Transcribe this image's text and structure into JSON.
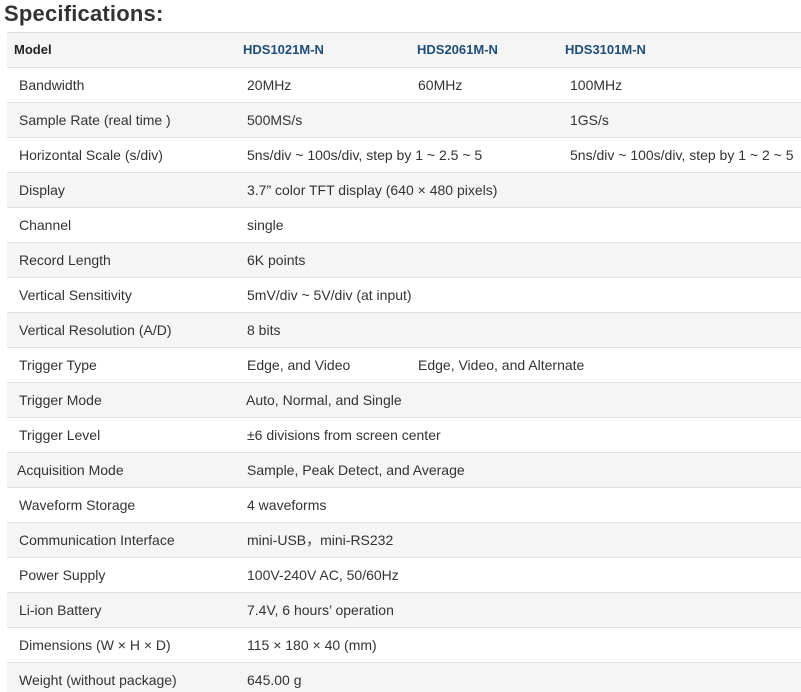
{
  "title": "Specifications:",
  "header": {
    "label": "Model",
    "models": [
      "HDS1021M-N",
      "HDS2061M-N",
      "HDS3101M-N"
    ]
  },
  "rows": [
    {
      "label": "Bandwidth",
      "v1": "20MHz",
      "v2": "60MHz",
      "v3": "100MHz"
    },
    {
      "label": "Sample Rate (real time )",
      "v1": "500MS/s",
      "v3": "1GS/s"
    },
    {
      "label": "Horizontal Scale (s/div)",
      "v1": "5ns/div ~ 100s/div, step by 1 ~ 2.5 ~ 5",
      "v3": "5ns/div ~ 100s/div, step by 1 ~ 2 ~ 5"
    },
    {
      "label": "Display",
      "v1": "3.7” color TFT display (640 × 480 pixels)"
    },
    {
      "label": "Channel",
      "v1": "single"
    },
    {
      "label": "Record Length",
      "v1": "6K points"
    },
    {
      "label": "Vertical Sensitivity",
      "v1": "5mV/div ~ 5V/div (at input)"
    },
    {
      "label": "Vertical Resolution (A/D)",
      "v1": "8 bits"
    },
    {
      "label": "Trigger Type",
      "v1": "Edge, and Video",
      "v2": "Edge, Video, and Alternate"
    },
    {
      "label": "Trigger Mode",
      "v1": "Auto, Normal, and Single"
    },
    {
      "label": "Trigger Level",
      "v1": "±6 divisions from screen center"
    },
    {
      "label": "Acquisition Mode",
      "v1": "Sample, Peak Detect, and Average"
    },
    {
      "label": "Waveform Storage",
      "v1": "4 waveforms"
    },
    {
      "label": "Communication Interface",
      "v1": "mini-USB，mini-RS232"
    },
    {
      "label": "Power Supply",
      "v1": "100V-240V AC, 50/60Hz"
    },
    {
      "label": "Li-ion Battery",
      "v1": "7.4V, 6 hours’ operation"
    },
    {
      "label": "Dimensions (W × H × D)",
      "v1": "115 × 180 × 40 (mm)"
    },
    {
      "label": "Weight (without package)",
      "v1": "645.00 g"
    }
  ]
}
